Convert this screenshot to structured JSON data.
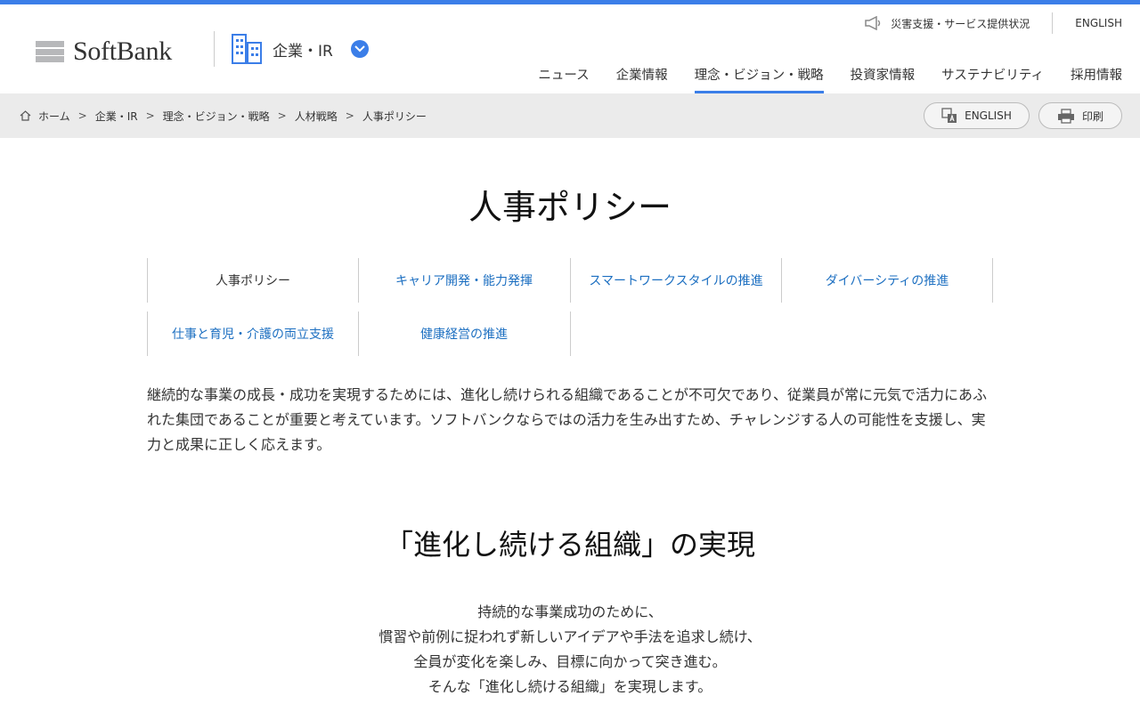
{
  "brand": {
    "name": "SoftBank",
    "section": "企業・IR"
  },
  "utility": {
    "disaster": "災害支援・サービス提供状況",
    "english": "ENGLISH"
  },
  "global_nav": [
    "ニュース",
    "企業情報",
    "理念・ビジョン・戦略",
    "投資家情報",
    "サステナビリティ",
    "採用情報"
  ],
  "global_nav_active": "理念・ビジョン・戦略",
  "breadcrumb": [
    "ホーム",
    "企業・IR",
    "理念・ビジョン・戦略",
    "人材戦略",
    "人事ポリシー"
  ],
  "actions": {
    "english": "ENGLISH",
    "print": "印刷"
  },
  "page": {
    "title": "人事ポリシー"
  },
  "tabs": [
    "人事ポリシー",
    "キャリア開発・能力発揮",
    "スマートワークスタイルの推進",
    "ダイバーシティの推進",
    "仕事と育児・介護の両立支援",
    "健康経営の推進"
  ],
  "intro": "継続的な事業の成長・成功を実現するためには、進化し続けられる組織であることが不可欠であり、従業員が常に元気で活力にあふれた集団であることが重要と考えています。ソフトバンクならではの活力を生み出すため、チャレンジする人の可能性を支援し、実力と成果に正しく応えます。",
  "section": {
    "title": "「進化し続ける組織」の実現",
    "lines": [
      "持続的な事業成功のために、",
      "慣習や前例に捉われず新しいアイデアや手法を追求し続け、",
      "全員が変化を楽しみ、目標に向かって突き進む。",
      "そんな「進化し続ける組織」を実現します。"
    ]
  },
  "colors": {
    "accent": "#3b7ee8",
    "link": "#1c6fc1",
    "logo_gray": "#b7b8ba",
    "crumb_bg": "#ebebeb"
  }
}
